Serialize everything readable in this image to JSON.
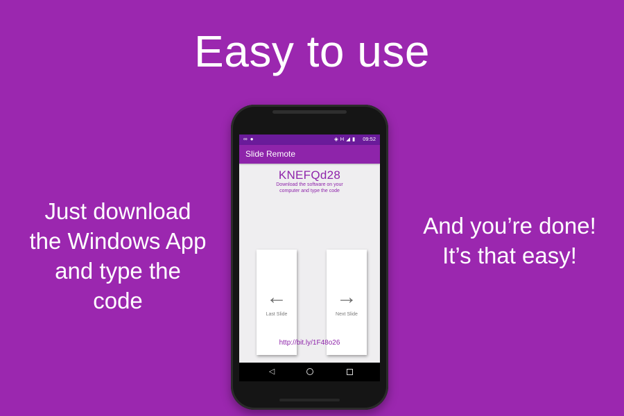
{
  "headline": "Easy to use",
  "left_text": "Just download the Windows App and type the code",
  "right_text": "And you’re done! It’s that easy!",
  "phone": {
    "status_bar": {
      "time": "09:52",
      "left_icons": [
        "link-icon",
        "location-icon"
      ],
      "right_icons": [
        "vibrate-icon",
        "signal-h-icon",
        "signal-icon",
        "battery-icon"
      ],
      "network": "H"
    },
    "app_title": "Slide Remote",
    "code": "KNEFQd28",
    "instructions": "Download the software on your computer and type the code",
    "buttons": {
      "last_label": "Last Slide",
      "next_label": "Next Slide"
    },
    "link": "http://bit.ly/1F48o26"
  },
  "colors": {
    "background": "#9b27af",
    "app_bar": "#8e24aa",
    "status_bar": "#6a1b9a",
    "screen_bg": "#efeef0"
  }
}
